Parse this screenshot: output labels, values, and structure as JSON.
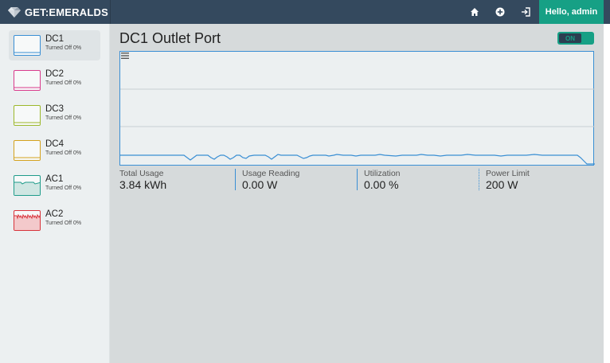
{
  "brand": {
    "name": "GET:EMERALDS"
  },
  "header": {
    "icons": [
      "home-icon",
      "add-circle-icon",
      "logout-icon"
    ],
    "user_label": "Hello, admin"
  },
  "sidebar": {
    "items": [
      {
        "name": "DC1",
        "status": "Turned Off 0%",
        "color": "#3a8fd4",
        "active": true
      },
      {
        "name": "DC2",
        "status": "Turned Off 0%",
        "color": "#d93b8c"
      },
      {
        "name": "DC3",
        "status": "Turned Off 0%",
        "color": "#9cb82b"
      },
      {
        "name": "DC4",
        "status": "Turned Off 0%",
        "color": "#d4a21e"
      },
      {
        "name": "AC1",
        "status": "Turned Off 0%",
        "color": "#1f9c8a"
      },
      {
        "name": "AC2",
        "status": "Turned Off 0%",
        "color": "#d8343b"
      }
    ]
  },
  "main": {
    "title": "DC1 Outlet Port",
    "toggle_label": "ON",
    "stats": [
      {
        "label": "Total Usage",
        "value": "3.84 kWh"
      },
      {
        "label": "Usage Reading",
        "value": "0.00 W"
      },
      {
        "label": "Utilization",
        "value": "0.00 %"
      },
      {
        "label": "Power Limit",
        "value": "200 W"
      }
    ]
  },
  "chart_data": {
    "type": "line",
    "title": "",
    "xlabel": "",
    "ylabel": "",
    "grid": true,
    "legend": "none",
    "series": [
      {
        "color": "#3a8fd4",
        "values": [
          0.26,
          0.26,
          0.26,
          0.26,
          0.26,
          0.26,
          0.26,
          0.26,
          0.26,
          0.26,
          0.26,
          0.26,
          0.26,
          0.26,
          0.26,
          0.26,
          0.26,
          0.26,
          0.26,
          0.26,
          0.26,
          0.26,
          0.26,
          0.26,
          0.26,
          0.26,
          0.26,
          0.26,
          0.26,
          0.26,
          0.26,
          0.26,
          0.26,
          0.26,
          0.26,
          0.26,
          0.26,
          0.26,
          0.26,
          0.26,
          0.26,
          0.26,
          0.26,
          0.26,
          0.26,
          0.26,
          0.26,
          0.26,
          0.26,
          0.26
        ]
      }
    ]
  }
}
